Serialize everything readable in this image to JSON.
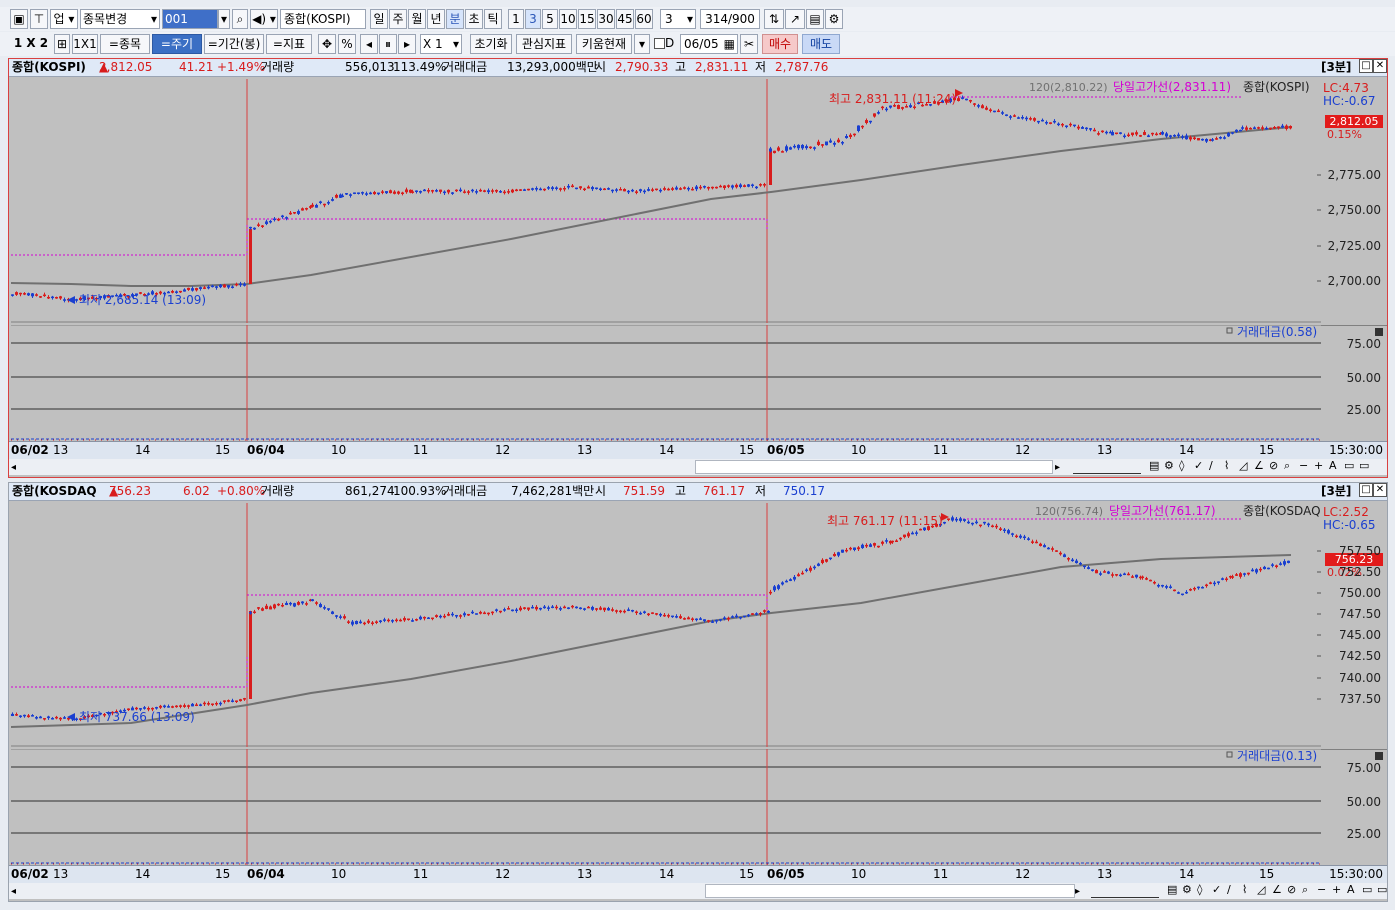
{
  "toolbar1": {
    "market_select": "업",
    "stock_change_label": "종목변경",
    "code_value": "001",
    "name_value": "종합(KOSPI)",
    "period_buttons": [
      "일",
      "주",
      "월",
      "년",
      "분",
      "초",
      "틱"
    ],
    "period_selected": "분",
    "interval_buttons": [
      "1",
      "3",
      "5",
      "10",
      "15",
      "30",
      "45",
      "60"
    ],
    "interval_selected": "3",
    "interval_select_value": "3",
    "count_value": "314",
    "count_max": "/900"
  },
  "toolbar2": {
    "layout_label": "1 X 2",
    "layout_1x1": "1X1",
    "btn_stock": "=종목",
    "btn_period": "=주기",
    "btn_range": "=기간(봉)",
    "btn_indicator": "=지표",
    "percent_label": "%",
    "zoom_select": "X 1",
    "btn_reset": "초기화",
    "btn_watch": "관심지표",
    "btn_kiwoom": "키움현재",
    "date_check_label": "D",
    "date_value": "06/05",
    "btn_buy": "매수",
    "btn_sell": "매도"
  },
  "panels": [
    {
      "name": "종합(KOSPI)",
      "price": "2,812.05",
      "change": "41.21",
      "change_pct": "+1.49%",
      "volume_label": "거래량",
      "volume": "556,013",
      "volume_pct": "113.49%",
      "amount_label": "거래대금",
      "amount": "13,293,000백만",
      "open_label": "시",
      "open": "2,790.33",
      "high_label": "고",
      "high": "2,831.11",
      "low_label": "저",
      "low": "2,787.76",
      "period_badge": "[3분]",
      "ma_label": "120(2,810.22)",
      "today_high_line": "당일고가선(2,831.11)",
      "series_label": "종합(KOSPI)",
      "lc": "LC:4.73",
      "hc": "HC:-0.67",
      "last_price_tag": "2,812.05",
      "last_pct_tag": "0.15%",
      "high_annot": "최고 2,831.11 (11:24)",
      "low_annot": "최저 2,685.14 (13:09)",
      "y_ticks": [
        "2,775.00",
        "2,750.00",
        "2,725.00",
        "2,700.00"
      ],
      "sub_label": "거래대금(0.58)",
      "sub_ticks": [
        "75.00",
        "50.00",
        "25.00"
      ],
      "x_labels": [
        "06/02",
        "13",
        "14",
        "15",
        "06/04",
        "10",
        "11",
        "12",
        "13",
        "14",
        "15",
        "06/05",
        "10",
        "11",
        "12",
        "13",
        "14",
        "15"
      ],
      "x_time": "15:30:00",
      "chart_data": {
        "type": "candlestick",
        "series": [
          {
            "name": "종합(KOSPI)"
          }
        ],
        "days": [
          "06/02",
          "06/04",
          "06/05"
        ],
        "high": 2831.11,
        "low": 2685.14,
        "last": 2812.05
      }
    },
    {
      "name": "종합(KOSDAQ",
      "price": "756.23",
      "change": "6.02",
      "change_pct": "+0.80%",
      "volume_label": "거래량",
      "volume": "861,274",
      "volume_pct": "100.93%",
      "amount_label": "거래대금",
      "amount": "7,462,281백만",
      "open_label": "시",
      "open": "751.59",
      "high_label": "고",
      "high": "761.17",
      "low_label": "저",
      "low": "750.17",
      "period_badge": "[3분]",
      "ma_label": "120(756.74)",
      "today_high_line": "당일고가선(761.17)",
      "series_label": "종합(KOSDAQ)",
      "lc": "LC:2.52",
      "hc": "HC:-0.65",
      "last_price_tag": "756.23",
      "last_pct_tag": "0.02%",
      "high_annot": "최고 761.17 (11:15)",
      "low_annot": "최저 737.66 (13:09)",
      "y_ticks": [
        "757.50",
        "752.50",
        "750.00",
        "747.50",
        "745.00",
        "742.50",
        "740.00",
        "737.50"
      ],
      "sub_label": "거래대금(0.13)",
      "sub_ticks": [
        "75.00",
        "50.00",
        "25.00"
      ],
      "x_labels": [
        "06/02",
        "13",
        "14",
        "15",
        "06/04",
        "10",
        "11",
        "12",
        "13",
        "14",
        "15",
        "06/05",
        "10",
        "11",
        "12",
        "13",
        "14",
        "15"
      ],
      "x_time": "15:30:00",
      "chart_data": {
        "type": "candlestick",
        "series": [
          {
            "name": "종합(KOSDAQ)"
          }
        ],
        "days": [
          "06/02",
          "06/04",
          "06/05"
        ],
        "high": 761.17,
        "low": 737.66,
        "last": 756.23
      }
    }
  ],
  "colors": {
    "up": "#d81c1c",
    "down": "#1a3fd0",
    "ma": "#707070",
    "highline": "#d400d4",
    "background": "#c0c0c0"
  }
}
